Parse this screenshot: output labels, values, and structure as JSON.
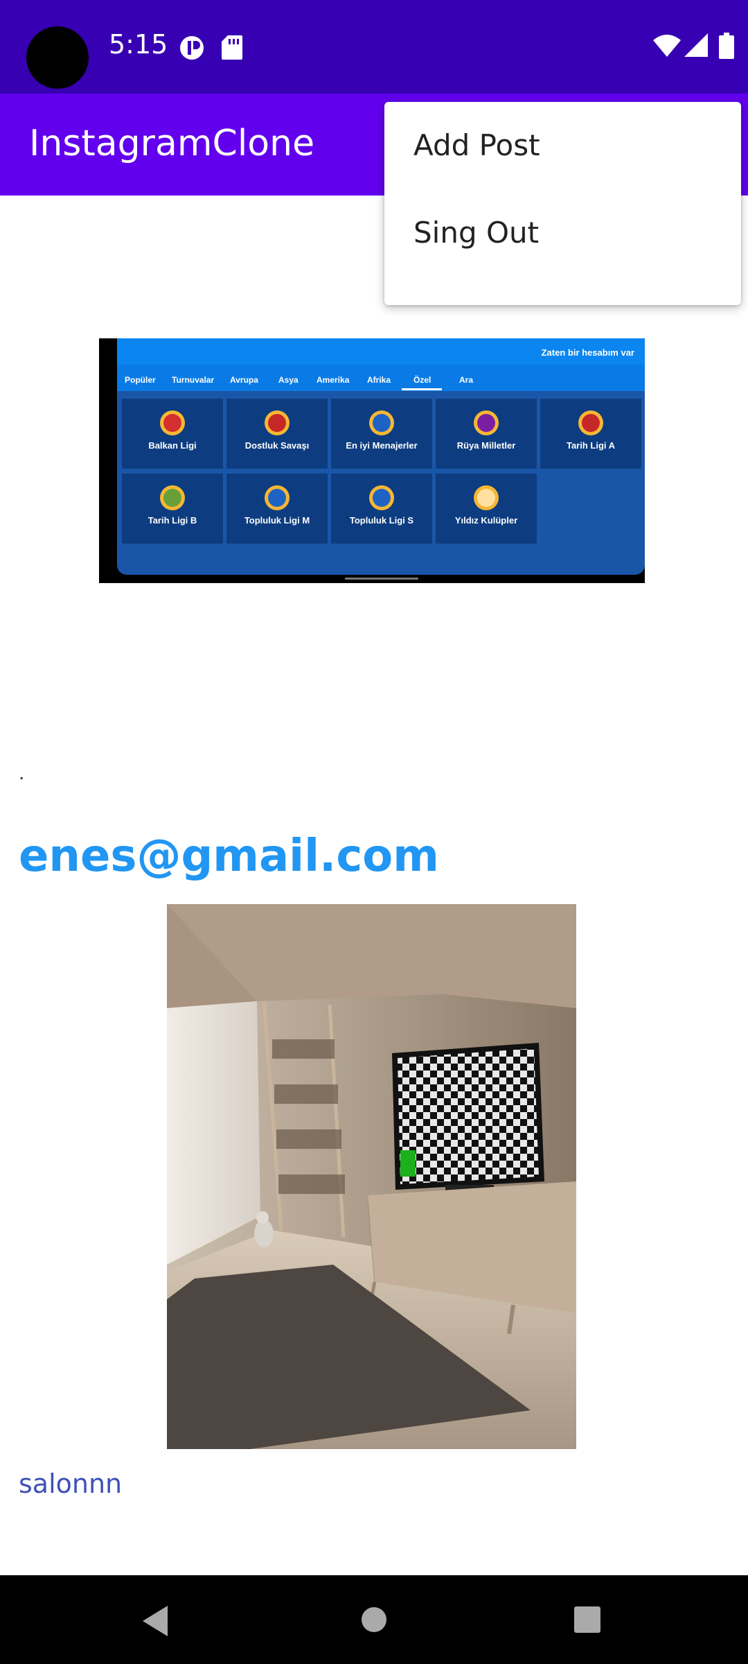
{
  "status_bar": {
    "time": "5:15"
  },
  "app_bar": {
    "title": "InstagramClone"
  },
  "menu": {
    "items": [
      {
        "label": "Add Post"
      },
      {
        "label": "Sing Out"
      }
    ]
  },
  "posts": [
    {
      "email": ".",
      "image": {
        "header_link": "Zaten bir hesabım var",
        "tabs": [
          "Popüler",
          "Turnuvalar",
          "Avrupa",
          "Asya",
          "Amerika",
          "Afrika",
          "Özel",
          "Ara"
        ],
        "selected_tab": "Özel",
        "leagues": [
          {
            "name": "Balkan Ligi",
            "color": "#d32f2f"
          },
          {
            "name": "Dostluk Savaşı",
            "color": "#c62828"
          },
          {
            "name": "En iyi Menajerler",
            "color": "#f57c00"
          },
          {
            "name": "Rüya Milletler",
            "color": "#7b1fa2"
          },
          {
            "name": "Tarih Ligi A",
            "color": "#c62828"
          },
          {
            "name": "Tarih Ligi B",
            "color": "#689f38"
          },
          {
            "name": "Topluluk Ligi M",
            "color": "#f57c00"
          },
          {
            "name": "Topluluk Ligi S",
            "color": "#f57c00"
          },
          {
            "name": "Yıldız Kulüpler",
            "color": "#ffa000"
          }
        ]
      }
    },
    {
      "email": "enes@gmail.com",
      "caption": "salonnn"
    }
  ],
  "colors": {
    "status_bar": "#3700b3",
    "app_bar": "#6200ee",
    "email": "#2196f3",
    "caption": "#3f51b5"
  }
}
